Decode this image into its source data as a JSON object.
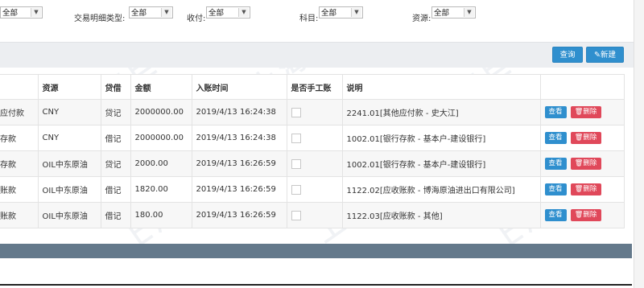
{
  "filters": {
    "first_select": "全部",
    "detail_type_label": "交易明细类型:",
    "detail_type_select": "全部",
    "payment_label": "收付:",
    "payment_select": "全部",
    "subject_label": "科目:",
    "subject_select": "全部",
    "source_label": "资源:",
    "source_select": "全部"
  },
  "toolbar": {
    "query_label": "查询",
    "new_label": "新建"
  },
  "table": {
    "headers": [
      "",
      "资源",
      "贷借",
      "金额",
      "入账时间",
      "是否手工账",
      "说明",
      ""
    ],
    "rows": [
      {
        "subject": "应付款",
        "source": "CNY",
        "dc": "贷记",
        "amount": "2000000.00",
        "time": "2019/4/13 16:24:38",
        "desc": "2241.01[其他应付款 - 史大江]"
      },
      {
        "subject": "存款",
        "source": "CNY",
        "dc": "借记",
        "amount": "2000000.00",
        "time": "2019/4/13 16:24:38",
        "desc": "1002.01[银行存款 - 基本户-建设银行]"
      },
      {
        "subject": "存款",
        "source": "OIL中东原油",
        "dc": "贷记",
        "amount": "2000.00",
        "time": "2019/4/13 16:26:59",
        "desc": "1002.01[银行存款 - 基本户-建设银行]"
      },
      {
        "subject": "账款",
        "source": "OIL中东原油",
        "dc": "借记",
        "amount": "1820.00",
        "time": "2019/4/13 16:26:59",
        "desc": "1122.02[应收账款 - 博海原油进出口有限公司]"
      },
      {
        "subject": "账款",
        "source": "OIL中东原油",
        "dc": "借记",
        "amount": "180.00",
        "time": "2019/4/13 16:26:59",
        "desc": "1122.03[应收账款 - 其他]"
      }
    ],
    "view_label": "查看",
    "delete_label": "删除"
  },
  "watermark": "上海巨沃",
  "colors": {
    "primary": "#2f8fce",
    "danger": "#e0485a",
    "footer": "#64798b",
    "toolbar_bg": "#eceef1"
  }
}
